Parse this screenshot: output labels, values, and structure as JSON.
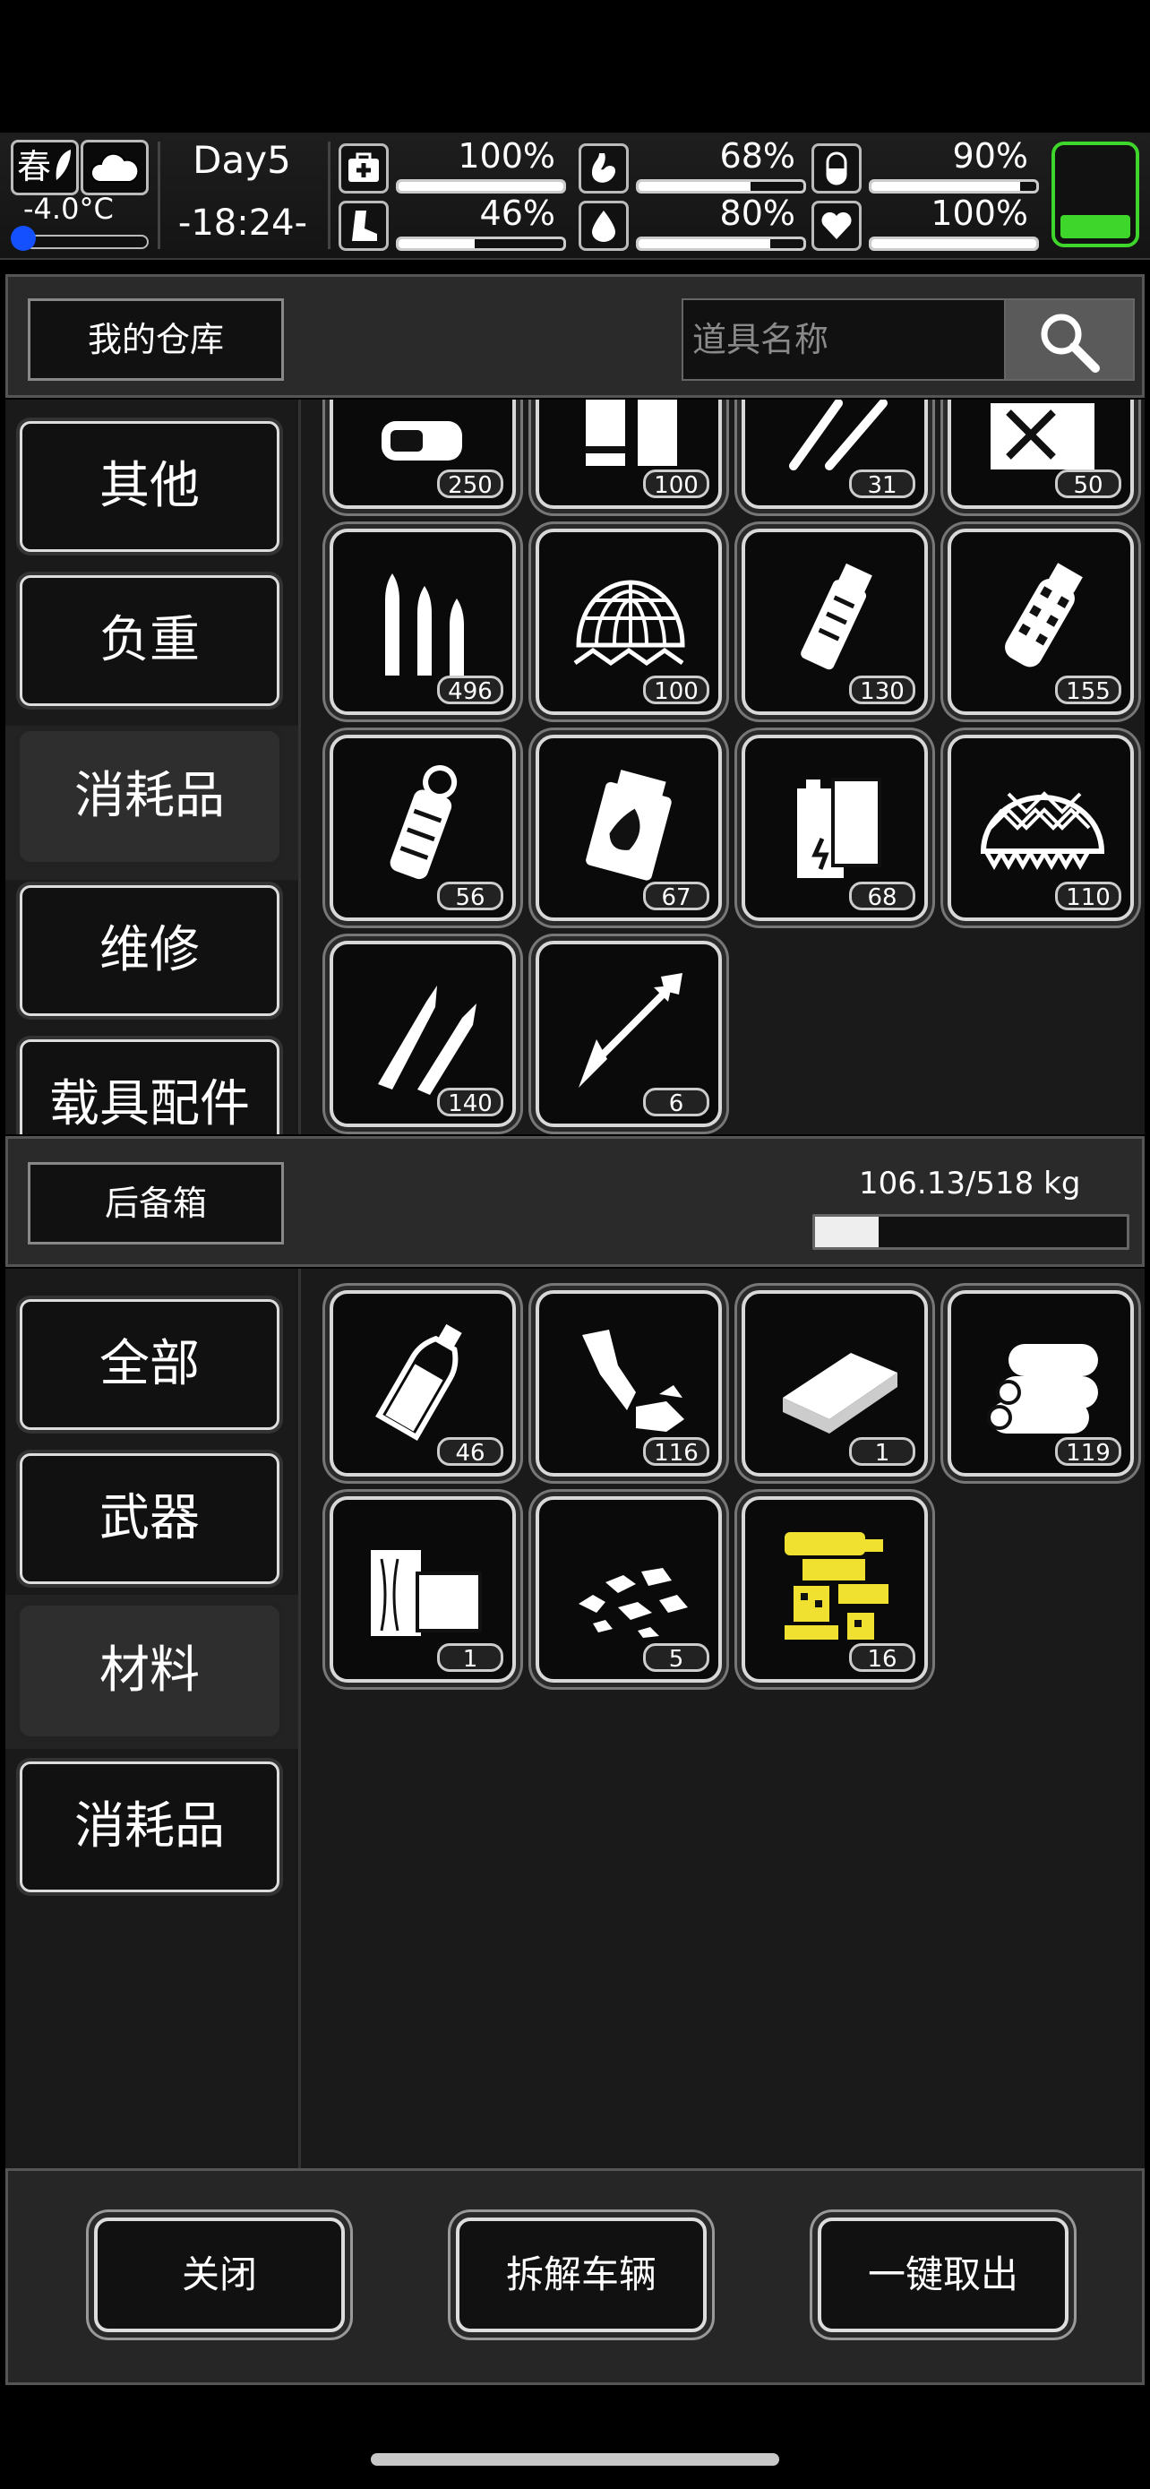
{
  "status": {
    "season": "春",
    "temperature": "-4.0°C",
    "day": "Day5",
    "time": "-18:24-",
    "stats": [
      {
        "name": "health",
        "icon": "medkit-icon",
        "value": "100%",
        "level": 1.0
      },
      {
        "name": "hunger",
        "icon": "stomach-icon",
        "value": "68%",
        "level": 0.68
      },
      {
        "name": "energy",
        "icon": "pill-icon",
        "value": "90%",
        "level": 0.9
      },
      {
        "name": "stamina",
        "icon": "foot-icon",
        "value": "46%",
        "level": 0.46
      },
      {
        "name": "thirst",
        "icon": "water-drop-icon",
        "value": "80%",
        "level": 0.8
      },
      {
        "name": "mood",
        "icon": "heart-icon",
        "value": "100%",
        "level": 1.0
      }
    ],
    "battery_level": 0.25,
    "battery_color": "#3ed62a"
  },
  "warehouse": {
    "title": "我的仓库",
    "search_placeholder": "道具名称",
    "categories": [
      "其他",
      "负重",
      "消耗品",
      "维修",
      "载具配件"
    ],
    "active_category": "消耗品",
    "items": [
      {
        "icon": "bullets-pack-icon",
        "count": "250"
      },
      {
        "icon": "batteries-icon",
        "count": "100"
      },
      {
        "icon": "needles-icon",
        "count": "31"
      },
      {
        "icon": "crate-icon",
        "count": "50"
      },
      {
        "icon": "rifle-ammo-icon",
        "count": "496"
      },
      {
        "icon": "net-trap-icon",
        "count": "100"
      },
      {
        "icon": "smoke-grenade-icon",
        "count": "130"
      },
      {
        "icon": "frag-grenade-icon",
        "count": "155"
      },
      {
        "icon": "flashbang-icon",
        "count": "56"
      },
      {
        "icon": "incendiary-charge-icon",
        "count": "67"
      },
      {
        "icon": "battery-cells-icon",
        "count": "68"
      },
      {
        "icon": "camo-net-icon",
        "count": "110"
      },
      {
        "icon": "sniper-rounds-icon",
        "count": "140"
      },
      {
        "icon": "arrow-icon",
        "count": "6"
      }
    ]
  },
  "trunk": {
    "title": "后备箱",
    "weight": "106.13/518 kg",
    "weight_fraction": 0.205,
    "categories": [
      "全部",
      "武器",
      "材料",
      "消耗品"
    ],
    "active_category": "材料",
    "items": [
      {
        "icon": "bottle-icon",
        "count": "46"
      },
      {
        "icon": "scrap-metal-icon",
        "count": "116"
      },
      {
        "icon": "plank-icon",
        "count": "1"
      },
      {
        "icon": "logs-icon",
        "count": "119"
      },
      {
        "icon": "wood-blocks-icon",
        "count": "1"
      },
      {
        "icon": "stones-icon",
        "count": "5"
      },
      {
        "icon": "gold-parts-icon",
        "count": "16"
      }
    ]
  },
  "footer": {
    "close": "关闭",
    "dismantle": "拆解车辆",
    "take_all": "一键取出"
  }
}
